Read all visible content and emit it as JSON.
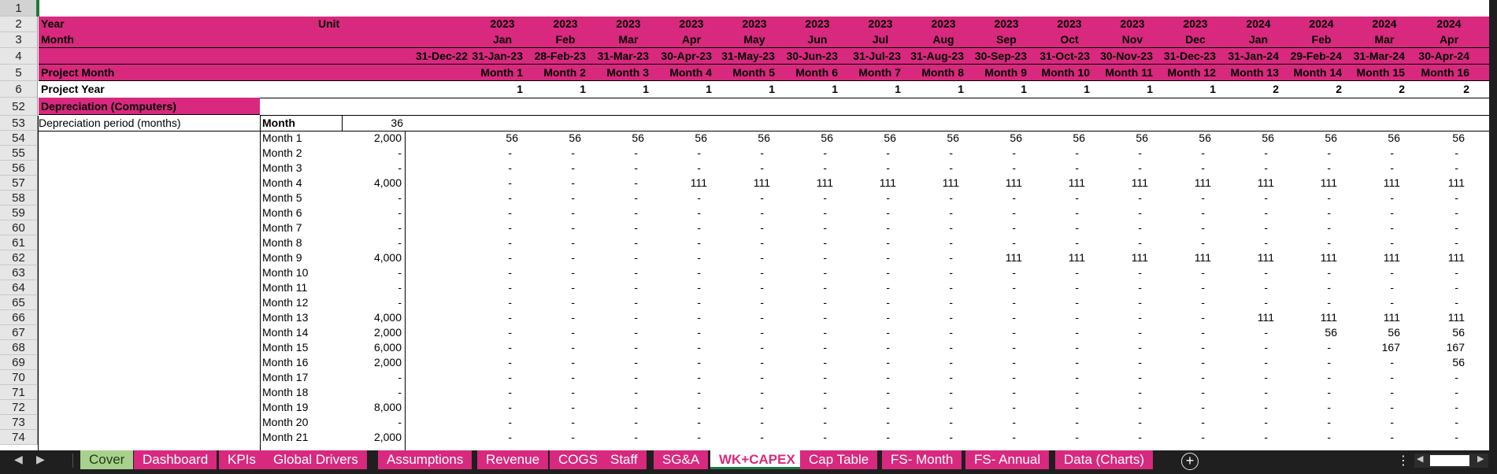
{
  "row_numbers": [
    "1",
    "2",
    "3",
    "4",
    "5",
    "6",
    "52",
    "53",
    "54",
    "55",
    "56",
    "57",
    "58",
    "59",
    "60",
    "61",
    "62",
    "63",
    "64",
    "65",
    "66",
    "67",
    "68",
    "69",
    "70",
    "71",
    "72",
    "73",
    "74"
  ],
  "header": {
    "year_label": "Year",
    "unit_label": "Unit",
    "month_label": "Month",
    "opening_date": "31-Dec-22",
    "project_month_label": "Project Month",
    "project_year_label": "Project Year",
    "columns": [
      {
        "year": "2023",
        "month": "Jan",
        "date": "31-Jan-23",
        "pmonth": "Month 1",
        "pyear": "1"
      },
      {
        "year": "2023",
        "month": "Feb",
        "date": "28-Feb-23",
        "pmonth": "Month 2",
        "pyear": "1"
      },
      {
        "year": "2023",
        "month": "Mar",
        "date": "31-Mar-23",
        "pmonth": "Month 3",
        "pyear": "1"
      },
      {
        "year": "2023",
        "month": "Apr",
        "date": "30-Apr-23",
        "pmonth": "Month 4",
        "pyear": "1"
      },
      {
        "year": "2023",
        "month": "May",
        "date": "31-May-23",
        "pmonth": "Month 5",
        "pyear": "1"
      },
      {
        "year": "2023",
        "month": "Jun",
        "date": "30-Jun-23",
        "pmonth": "Month 6",
        "pyear": "1"
      },
      {
        "year": "2023",
        "month": "Jul",
        "date": "31-Jul-23",
        "pmonth": "Month 7",
        "pyear": "1"
      },
      {
        "year": "2023",
        "month": "Aug",
        "date": "31-Aug-23",
        "pmonth": "Month 8",
        "pyear": "1"
      },
      {
        "year": "2023",
        "month": "Sep",
        "date": "30-Sep-23",
        "pmonth": "Month 9",
        "pyear": "1"
      },
      {
        "year": "2023",
        "month": "Oct",
        "date": "31-Oct-23",
        "pmonth": "Month 10",
        "pyear": "1"
      },
      {
        "year": "2023",
        "month": "Nov",
        "date": "30-Nov-23",
        "pmonth": "Month 11",
        "pyear": "1"
      },
      {
        "year": "2023",
        "month": "Dec",
        "date": "31-Dec-23",
        "pmonth": "Month 12",
        "pyear": "1"
      },
      {
        "year": "2024",
        "month": "Jan",
        "date": "31-Jan-24",
        "pmonth": "Month 13",
        "pyear": "2"
      },
      {
        "year": "2024",
        "month": "Feb",
        "date": "29-Feb-24",
        "pmonth": "Month 14",
        "pyear": "2"
      },
      {
        "year": "2024",
        "month": "Mar",
        "date": "31-Mar-24",
        "pmonth": "Month 15",
        "pyear": "2"
      },
      {
        "year": "2024",
        "month": "Apr",
        "date": "30-Apr-24",
        "pmonth": "Month 16",
        "pyear": "2"
      }
    ]
  },
  "section": {
    "title": "Depreciation (Computers)",
    "period_label": "Depreciation period (months)",
    "period_unit": "Month",
    "period_value": "36"
  },
  "rows": [
    {
      "label": "Month 1",
      "amount": "2,000",
      "values": [
        "56",
        "56",
        "56",
        "56",
        "56",
        "56",
        "56",
        "56",
        "56",
        "56",
        "56",
        "56",
        "56",
        "56",
        "56",
        "56"
      ]
    },
    {
      "label": "Month 2",
      "amount": "-",
      "values": [
        "-",
        "-",
        "-",
        "-",
        "-",
        "-",
        "-",
        "-",
        "-",
        "-",
        "-",
        "-",
        "-",
        "-",
        "-",
        "-"
      ]
    },
    {
      "label": "Month 3",
      "amount": "-",
      "values": [
        "-",
        "-",
        "-",
        "-",
        "-",
        "-",
        "-",
        "-",
        "-",
        "-",
        "-",
        "-",
        "-",
        "-",
        "-",
        "-"
      ]
    },
    {
      "label": "Month 4",
      "amount": "4,000",
      "values": [
        "-",
        "-",
        "-",
        "111",
        "111",
        "111",
        "111",
        "111",
        "111",
        "111",
        "111",
        "111",
        "111",
        "111",
        "111",
        "111"
      ]
    },
    {
      "label": "Month 5",
      "amount": "-",
      "values": [
        "-",
        "-",
        "-",
        "-",
        "-",
        "-",
        "-",
        "-",
        "-",
        "-",
        "-",
        "-",
        "-",
        "-",
        "-",
        "-"
      ]
    },
    {
      "label": "Month 6",
      "amount": "-",
      "values": [
        "-",
        "-",
        "-",
        "-",
        "-",
        "-",
        "-",
        "-",
        "-",
        "-",
        "-",
        "-",
        "-",
        "-",
        "-",
        "-"
      ]
    },
    {
      "label": "Month 7",
      "amount": "-",
      "values": [
        "-",
        "-",
        "-",
        "-",
        "-",
        "-",
        "-",
        "-",
        "-",
        "-",
        "-",
        "-",
        "-",
        "-",
        "-",
        "-"
      ]
    },
    {
      "label": "Month 8",
      "amount": "-",
      "values": [
        "-",
        "-",
        "-",
        "-",
        "-",
        "-",
        "-",
        "-",
        "-",
        "-",
        "-",
        "-",
        "-",
        "-",
        "-",
        "-"
      ]
    },
    {
      "label": "Month 9",
      "amount": "4,000",
      "values": [
        "-",
        "-",
        "-",
        "-",
        "-",
        "-",
        "-",
        "-",
        "111",
        "111",
        "111",
        "111",
        "111",
        "111",
        "111",
        "111"
      ]
    },
    {
      "label": "Month 10",
      "amount": "-",
      "values": [
        "-",
        "-",
        "-",
        "-",
        "-",
        "-",
        "-",
        "-",
        "-",
        "-",
        "-",
        "-",
        "-",
        "-",
        "-",
        "-"
      ]
    },
    {
      "label": "Month 11",
      "amount": "-",
      "values": [
        "-",
        "-",
        "-",
        "-",
        "-",
        "-",
        "-",
        "-",
        "-",
        "-",
        "-",
        "-",
        "-",
        "-",
        "-",
        "-"
      ]
    },
    {
      "label": "Month 12",
      "amount": "-",
      "values": [
        "-",
        "-",
        "-",
        "-",
        "-",
        "-",
        "-",
        "-",
        "-",
        "-",
        "-",
        "-",
        "-",
        "-",
        "-",
        "-"
      ]
    },
    {
      "label": "Month 13",
      "amount": "4,000",
      "values": [
        "-",
        "-",
        "-",
        "-",
        "-",
        "-",
        "-",
        "-",
        "-",
        "-",
        "-",
        "-",
        "111",
        "111",
        "111",
        "111"
      ]
    },
    {
      "label": "Month 14",
      "amount": "2,000",
      "values": [
        "-",
        "-",
        "-",
        "-",
        "-",
        "-",
        "-",
        "-",
        "-",
        "-",
        "-",
        "-",
        "-",
        "56",
        "56",
        "56"
      ]
    },
    {
      "label": "Month 15",
      "amount": "6,000",
      "values": [
        "-",
        "-",
        "-",
        "-",
        "-",
        "-",
        "-",
        "-",
        "-",
        "-",
        "-",
        "-",
        "-",
        "-",
        "167",
        "167"
      ]
    },
    {
      "label": "Month 16",
      "amount": "2,000",
      "values": [
        "-",
        "-",
        "-",
        "-",
        "-",
        "-",
        "-",
        "-",
        "-",
        "-",
        "-",
        "-",
        "-",
        "-",
        "-",
        "56"
      ]
    },
    {
      "label": "Month 17",
      "amount": "-",
      "values": [
        "-",
        "-",
        "-",
        "-",
        "-",
        "-",
        "-",
        "-",
        "-",
        "-",
        "-",
        "-",
        "-",
        "-",
        "-",
        "-"
      ]
    },
    {
      "label": "Month 18",
      "amount": "-",
      "values": [
        "-",
        "-",
        "-",
        "-",
        "-",
        "-",
        "-",
        "-",
        "-",
        "-",
        "-",
        "-",
        "-",
        "-",
        "-",
        "-"
      ]
    },
    {
      "label": "Month 19",
      "amount": "8,000",
      "values": [
        "-",
        "-",
        "-",
        "-",
        "-",
        "-",
        "-",
        "-",
        "-",
        "-",
        "-",
        "-",
        "-",
        "-",
        "-",
        "-"
      ]
    },
    {
      "label": "Month 20",
      "amount": "-",
      "values": [
        "-",
        "-",
        "-",
        "-",
        "-",
        "-",
        "-",
        "-",
        "-",
        "-",
        "-",
        "-",
        "-",
        "-",
        "-",
        "-"
      ]
    },
    {
      "label": "Month 21",
      "amount": "2,000",
      "values": [
        "-",
        "-",
        "-",
        "-",
        "-",
        "-",
        "-",
        "-",
        "-",
        "-",
        "-",
        "-",
        "-",
        "-",
        "-",
        "-"
      ]
    }
  ],
  "tabs": [
    {
      "label": "Cover",
      "style": "green"
    },
    {
      "label": "Dashboard",
      "style": "pink"
    },
    {
      "label": "KPIs",
      "style": "pink"
    },
    {
      "label": "Global Drivers",
      "style": "pink"
    },
    {
      "label": "Assumptions",
      "style": "pink"
    },
    {
      "label": "Revenue",
      "style": "pink"
    },
    {
      "label": "COGS",
      "style": "pink"
    },
    {
      "label": "Staff",
      "style": "pink"
    },
    {
      "label": "SG&A",
      "style": "pink"
    },
    {
      "label": "WK+CAPEX",
      "style": "active"
    },
    {
      "label": "Cap Table",
      "style": "pink"
    },
    {
      "label": "FS- Month",
      "style": "pink"
    },
    {
      "label": "FS- Annual",
      "style": "pink"
    },
    {
      "label": "Data (Charts)",
      "style": "pink"
    }
  ],
  "icons": {
    "prev_sheet": "◀",
    "next_sheet": "▶",
    "add_sheet": "+",
    "more": "⋮",
    "scroll_left": "◀",
    "scroll_right": "▶"
  },
  "colors": {
    "header_fill": "#d8297e",
    "active_tab_text": "#d8297e",
    "cover_tab": "#a9d18e",
    "selection": "#1f7a3a"
  }
}
